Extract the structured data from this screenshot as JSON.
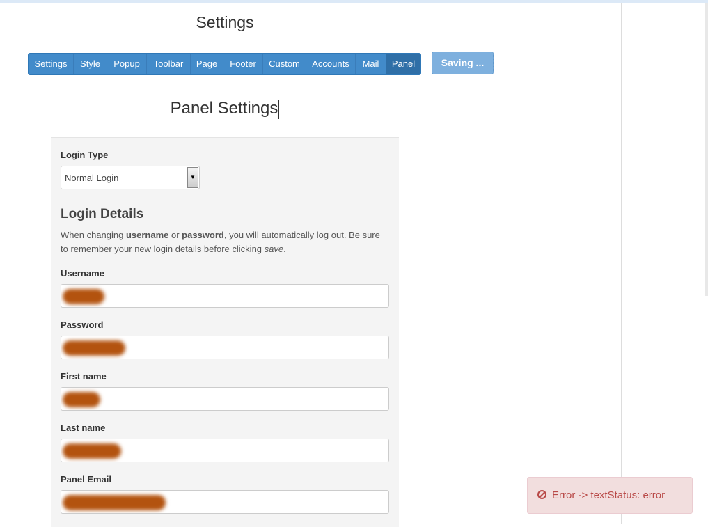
{
  "header": {
    "title": "Settings"
  },
  "tabs": [
    {
      "label": "Settings"
    },
    {
      "label": "Style"
    },
    {
      "label": "Popup"
    },
    {
      "label": "Toolbar"
    },
    {
      "label": "Page"
    },
    {
      "label": "Footer"
    },
    {
      "label": "Custom"
    },
    {
      "label": "Accounts"
    },
    {
      "label": "Mail"
    },
    {
      "label": "Panel",
      "active": true
    }
  ],
  "saving_label": "Saving ...",
  "section_title": "Panel Settings",
  "form": {
    "login_type_label": "Login Type",
    "login_type_value": "Normal Login",
    "details_title": "Login Details",
    "help": {
      "p1": "When changing ",
      "b1": "username",
      "p2": " or ",
      "b2": "password",
      "p3": ", you will automatically log out. Be sure to remember your new login details before clicking ",
      "i1": "save",
      "p4": "."
    },
    "fields": [
      {
        "label": "Username",
        "redacted": true
      },
      {
        "label": "Password",
        "redacted": true
      },
      {
        "label": "First name",
        "redacted": true
      },
      {
        "label": "Last name",
        "redacted": true
      },
      {
        "label": "Panel Email",
        "redacted": true
      }
    ]
  },
  "toast": {
    "icon": "ban-icon",
    "message": "Error -> textStatus: error"
  },
  "colors": {
    "primary": "#428bca",
    "active_tab": "#2f6fa7",
    "error_bg": "#f2dede",
    "error_text": "#b94a48"
  }
}
